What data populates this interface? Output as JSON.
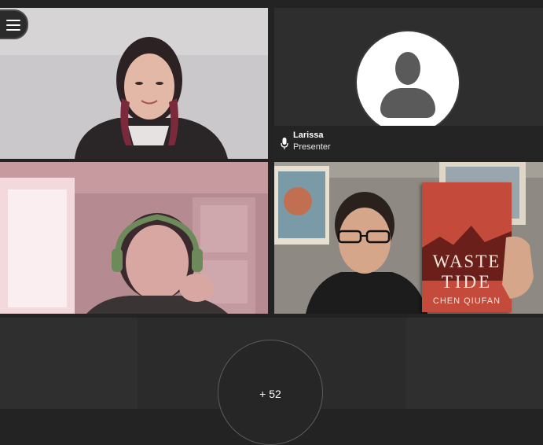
{
  "participants": [
    {
      "name": "",
      "role": "",
      "video": "on"
    },
    {
      "name": "Larissa",
      "role": "Presenter",
      "video": "off"
    },
    {
      "name": "",
      "role": "",
      "video": "on"
    },
    {
      "name": "",
      "role": "",
      "video": "on"
    }
  ],
  "book": {
    "title_line1": "WASTE",
    "title_line2": "TIDE",
    "author": "CHEN QIUFAN"
  },
  "overflow": {
    "label": "+ 52"
  },
  "colors": {
    "background": "#232323",
    "tile_dark": "#2e2e2e",
    "avatar_bg": "#ffffff",
    "avatar_fg": "#5a5a5a",
    "book_red": "#c44a3c"
  },
  "icons": {
    "menu": "hamburger-menu-icon",
    "mic": "microphone-icon",
    "avatar": "user-placeholder-icon"
  }
}
